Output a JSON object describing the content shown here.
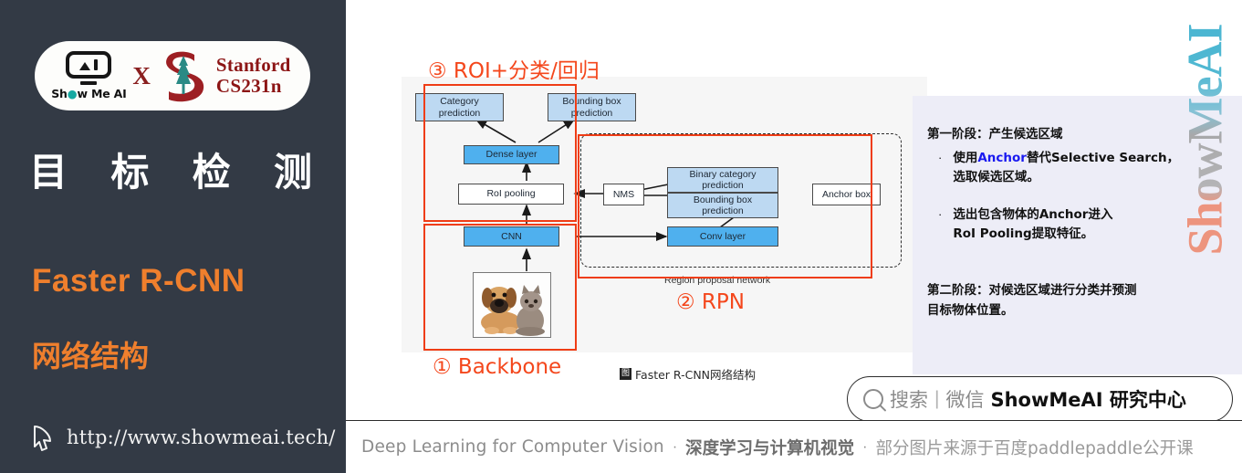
{
  "sidebar": {
    "badge": {
      "brand_name": "Show Me AI",
      "cross": "X",
      "partner_line1": "Stanford",
      "partner_line2": "CS231n"
    },
    "topic_chars": [
      "目",
      "标",
      "检",
      "测"
    ],
    "title_en": "Faster R-CNN",
    "title_cn": "网络结构",
    "url": "http://www.showmeai.tech/"
  },
  "figure": {
    "nodes": {
      "category_prediction": "Category\nprediction",
      "bounding_box_prediction": "Bounding box\nprediction",
      "dense_layer": "Dense layer",
      "roi_pooling": "RoI pooling",
      "cnn": "CNN",
      "nms": "NMS",
      "binary_category_prediction": "Binary category\nprediction",
      "rpn_bounding_box_prediction": "Bounding box\nprediction",
      "anchor_box": "Anchor box",
      "conv_layer": "Conv layer"
    },
    "rpn_caption": "Region proposal network",
    "annotations": {
      "roi": "③ ROI+分类/回归",
      "rpn": "② RPN",
      "backbone": "① Backbone"
    },
    "caption_badge": "图",
    "caption_text": "Faster R-CNN网络结构"
  },
  "notes": {
    "stage1_heading": "第一阶段：产生候选区域",
    "bullets": [
      {
        "marker": "·",
        "line1_pre": "使用",
        "line1_hl": "Anchor",
        "line1_post": "替代Selective Search，",
        "line2": "选取候选区域。"
      },
      {
        "marker": "·",
        "line1_pre": "选出包含物体的Anchor进入",
        "line1_hl": "",
        "line1_post": "",
        "line2": "RoI Pooling提取特征。"
      }
    ],
    "stage2_line1": "第二阶段：对候选区域进行分类并预测",
    "stage2_line2": "目标物体位置。"
  },
  "watermark": "ShowMeAI",
  "search_bar": {
    "placeholder": "搜索",
    "divider": "|",
    "channel": "微信",
    "account": "ShowMeAI 研究中心"
  },
  "footer": {
    "title_en": "Deep Learning for Computer Vision",
    "sep1": "·",
    "title_cn": "深度学习与计算机视觉",
    "sep2": "·",
    "source": "部分图片来源于百度paddlepaddle公开课"
  },
  "colors": {
    "sidebar_bg": "#333a45",
    "accent_orange": "#ef7f2d",
    "annotation_red": "#f4471c",
    "node_light_blue": "#bdd9f2",
    "node_blue": "#4fb0ee",
    "note_panel_bg": "#ededf7",
    "highlight_blue": "#1a1af0"
  }
}
